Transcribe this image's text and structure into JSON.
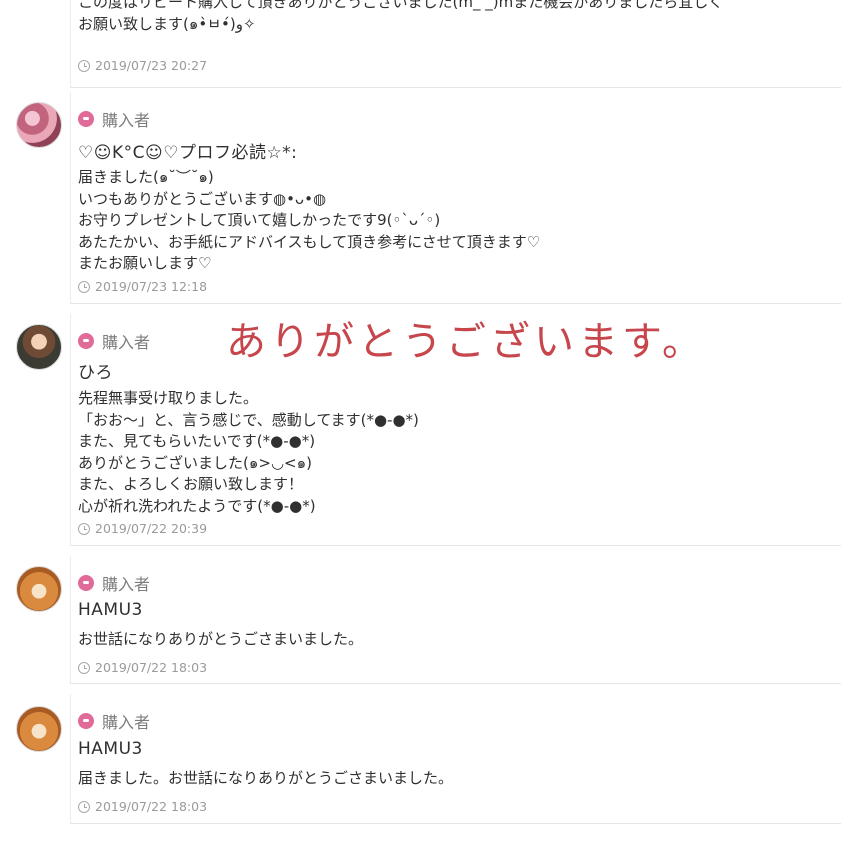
{
  "overlay_text": "ありがとうございます。",
  "reviews": [
    {
      "message": "この度はリピート購入して頂きありがとうございました(m_ _)mまた機会がありましたら宜しく\nお願い致します(๑•̀ㅂ•́)و✧",
      "timestamp": "2019/07/23 20:27"
    },
    {
      "role": "購入者",
      "avatar": "pink-flower-avatar",
      "name": "♡☺K°C☺♡プロフ必読☆*:",
      "message": "届きました(๑˘︶˘๑)\nいつもありがとうございます◍•ᴗ•◍\nお守りプレゼントして頂いて嬉しかったです9(◦`ᴗ´◦)\nあたたかい、お手紙にアドバイスもして頂き参考にさせて頂きます♡\nまたお願いします♡",
      "timestamp": "2019/07/23 12:18"
    },
    {
      "role": "購入者",
      "avatar": "person-avatar",
      "name": "ひろ",
      "message": "先程無事受け取りました。\n「おお～」と、言う感じで、感動してます(*●-●*)\nまた、見てもらいたいです(*●-●*)\nありがとうございました(๑>◡<๑)\nまた、よろしくお願い致します！\n心が祈れ洗われたようです(*●-●*)",
      "timestamp": "2019/07/22 20:39"
    },
    {
      "role": "購入者",
      "avatar": "hamster-avatar",
      "name": "HAMU3",
      "message": "お世話になりありがとうごさまいました。",
      "timestamp": "2019/07/22 18:03"
    },
    {
      "role": "購入者",
      "avatar": "hamster-avatar",
      "name": "HAMU3",
      "message": "届きました。お世話になりありがとうごさまいました。",
      "timestamp": "2019/07/22 18:03"
    }
  ]
}
